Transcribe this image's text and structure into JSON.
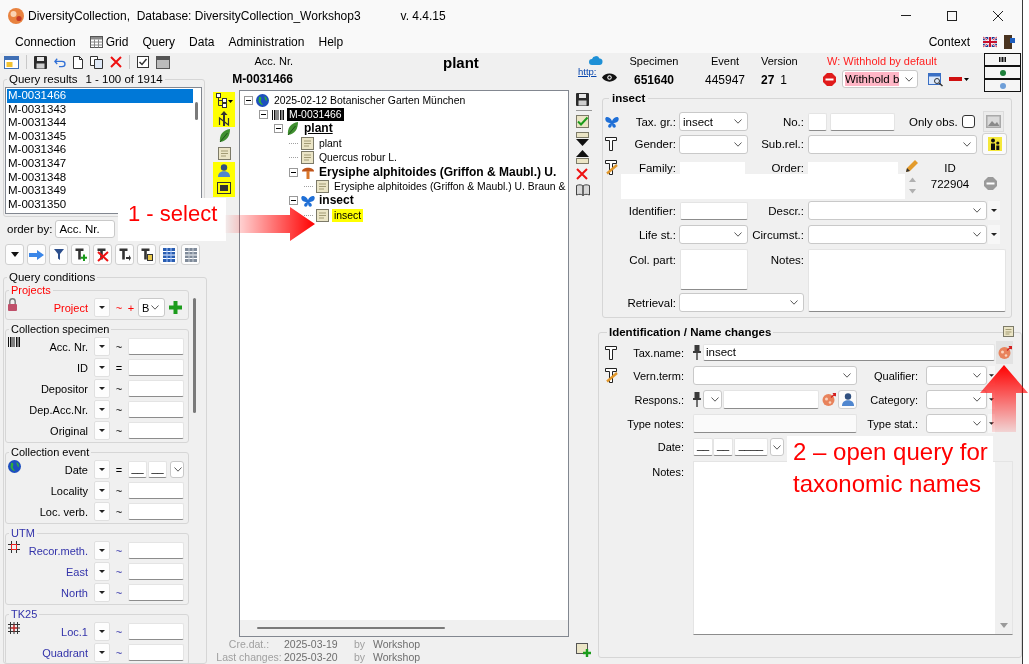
{
  "window": {
    "title": "DiversityCollection,  Database: DiversityCollection_Workshop3",
    "version": "v. 4.4.15"
  },
  "menu": {
    "items": [
      {
        "label": "Connection",
        "kind": "text"
      },
      {
        "label": "Grid",
        "kind": "icon"
      },
      {
        "label": "Query",
        "kind": "text"
      },
      {
        "label": "Data",
        "kind": "text"
      },
      {
        "label": "Administration",
        "kind": "text"
      },
      {
        "label": "Help",
        "kind": "text"
      }
    ],
    "context": "Context"
  },
  "query_results": {
    "title": "Query results",
    "range": "1 - 100 of 1914",
    "items": [
      {
        "label": "M-0031466",
        "selected": true
      },
      {
        "label": "M-0031343",
        "selected": false
      },
      {
        "label": "M-0031344",
        "selected": false
      },
      {
        "label": "M-0031345",
        "selected": false
      },
      {
        "label": "M-0031346",
        "selected": false
      },
      {
        "label": "M-0031347",
        "selected": false
      },
      {
        "label": "M-0031348",
        "selected": false
      },
      {
        "label": "M-0031349",
        "selected": false
      },
      {
        "label": "M-0031350",
        "selected": false
      }
    ]
  },
  "order_by": {
    "label": "order by:",
    "value": "Acc. Nr."
  },
  "query_conditions": {
    "title": "Query conditions",
    "groups": [
      {
        "title": "Projects",
        "color": "#ff0000",
        "rows": [
          {
            "kind": "project",
            "label": "Project",
            "operator": "~",
            "extra": "+",
            "value": "B"
          }
        ]
      },
      {
        "title": "Collection specimen",
        "rows": [
          {
            "kind": "text",
            "label": "Acc. Nr.",
            "operator": "~"
          },
          {
            "kind": "text",
            "label": "ID",
            "operator": "="
          },
          {
            "kind": "text",
            "label": "Depositor",
            "operator": "~"
          },
          {
            "kind": "text",
            "label": "Dep.Acc.Nr.",
            "operator": "~"
          },
          {
            "kind": "text",
            "label": "Original",
            "operator": "~"
          }
        ]
      },
      {
        "title": "Collection event",
        "rows": [
          {
            "kind": "date",
            "label": "Date",
            "operator": "=",
            "parts": [
              "__",
              "__"
            ]
          },
          {
            "kind": "text",
            "label": "Locality",
            "operator": "~"
          },
          {
            "kind": "text",
            "label": "Loc. verb.",
            "operator": "~"
          }
        ]
      },
      {
        "title": "UTM",
        "color": "#3333aa",
        "rows": [
          {
            "kind": "text",
            "label": "Recor.meth.",
            "operator": "~"
          },
          {
            "kind": "text",
            "label": "East",
            "operator": "~"
          },
          {
            "kind": "text",
            "label": "North",
            "operator": "~"
          }
        ]
      },
      {
        "title": "TK25",
        "color": "#3333aa",
        "rows": [
          {
            "kind": "text",
            "label": "Loc.1",
            "operator": "~"
          },
          {
            "kind": "text",
            "label": "Quadrant",
            "operator": "~"
          }
        ]
      }
    ]
  },
  "specimen_header": {
    "label": "Acc. Nr.",
    "value": "M-0031466",
    "unit": "plant"
  },
  "tree_tools": [
    {
      "on": true
    },
    {
      "on": true
    },
    {
      "on": false
    },
    {
      "on": false
    },
    {
      "on": true
    },
    {
      "on": true
    }
  ],
  "tree": [
    {
      "kind": "event",
      "label": "2025-02-12 Botanischer Garten München",
      "expanded": true,
      "selected": false,
      "children": [
        {
          "kind": "specimen",
          "label": "M-0031466",
          "expanded": true,
          "selected": false,
          "children": [
            {
              "kind": "plant",
              "label": "plant",
              "main": true,
              "expanded": true,
              "selected": false,
              "children": [
                {
                  "kind": "identification",
                  "label": "plant",
                  "selected": false
                },
                {
                  "kind": "identification",
                  "label": "Quercus robur L.",
                  "selected": false
                },
                {
                  "kind": "fungus",
                  "label": "Erysiphe alphitoides (Griffon & Maubl.) U.",
                  "main": false,
                  "expanded": true,
                  "selected": false,
                  "children": [
                    {
                      "kind": "identification",
                      "label": "Erysiphe alphitoides (Griffon & Maubl.) U. Braun &",
                      "selected": false
                    }
                  ]
                },
                {
                  "kind": "insect",
                  "label": "insect",
                  "main": false,
                  "expanded": true,
                  "selected": false,
                  "children": [
                    {
                      "kind": "identification",
                      "label": "insect",
                      "selected": true
                    }
                  ]
                }
              ]
            }
          ]
        }
      ]
    }
  ],
  "footer": {
    "created": {
      "label": "Cre.dat.:",
      "date": "2025-03-19",
      "by": "by",
      "user": "Workshop"
    },
    "changed": {
      "label": "Last changes:",
      "date": "2025-03-20",
      "by": "by",
      "user": "Workshop"
    }
  },
  "record": {
    "link": "http:",
    "specimen": {
      "label": "Specimen",
      "value": "651640"
    },
    "event": {
      "label": "Event",
      "value": "445947"
    },
    "version": {
      "label": "Version",
      "value": "27",
      "sub_value": "1"
    },
    "withholding": {
      "warning": "W: Withhold by default",
      "value": "Withhold b"
    }
  },
  "unit": {
    "title": "insect",
    "tax_group": {
      "label": "Tax. gr.:",
      "value": "insect"
    },
    "number": {
      "label": "No.:"
    },
    "only_observed": {
      "label": "Only obs.",
      "checked": false
    },
    "gender": {
      "label": "Gender:"
    },
    "sub_relation": {
      "label": "Sub.rel.:"
    },
    "family": {
      "label": "Family:"
    },
    "order": {
      "label": "Order:"
    },
    "id": {
      "label": "ID",
      "value": "722904"
    },
    "identifier": {
      "label": "Identifier:"
    },
    "description": {
      "label": "Descr.:"
    },
    "life_stage": {
      "label": "Life st.:"
    },
    "circumstances": {
      "label": "Circumst.:"
    },
    "collected_part": {
      "label": "Col. part:"
    },
    "notes": {
      "label": "Notes:"
    },
    "retrieval": {
      "label": "Retrieval:"
    }
  },
  "identification": {
    "title": "Identification / Name changes",
    "taxon_name": {
      "label": "Tax.name:",
      "value": "insect"
    },
    "vernacular_term": {
      "label": "Vern.term:"
    },
    "qualifier": {
      "label": "Qualifier:"
    },
    "responsible": {
      "label": "Respons.:"
    },
    "category": {
      "label": "Category:"
    },
    "type_notes": {
      "label": "Type notes:"
    },
    "type_status": {
      "label": "Type stat.:"
    },
    "date": {
      "label": "Date:",
      "parts": [
        "__",
        "__",
        "____"
      ]
    },
    "notes": {
      "label": "Notes:"
    }
  },
  "annotations": [
    {
      "kind": "right",
      "text": "1 - select"
    },
    {
      "kind": "up",
      "text": "2 – open query for taxonomic names"
    }
  ]
}
